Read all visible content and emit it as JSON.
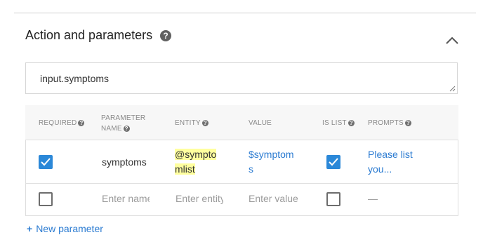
{
  "section": {
    "title": "Action and parameters",
    "help_icon": "?"
  },
  "action_input": {
    "value": "input.symptoms"
  },
  "table": {
    "headers": {
      "required": "REQUIRED",
      "parameter_name_line1": "PARAMETER",
      "parameter_name_line2": "NAME",
      "entity": "ENTITY",
      "value": "VALUE",
      "is_list": "IS LIST",
      "prompts": "PROMPTS",
      "help_icon": "?"
    },
    "rows": [
      {
        "required": true,
        "name": "symptoms",
        "entity_line1": "@sympto",
        "entity_line2": "mlist",
        "value_line1": "$symptom",
        "value_line2": "s",
        "is_list": true,
        "prompts_line1": "Please list",
        "prompts_line2": "you..."
      }
    ],
    "empty_row": {
      "required": false,
      "name_placeholder": "Enter name",
      "entity_placeholder": "Enter entity",
      "value_placeholder": "Enter value",
      "is_list": false,
      "prompts": "—"
    }
  },
  "new_parameter": {
    "plus": "+",
    "label": "New parameter"
  },
  "icons": {
    "help": "help-circle-icon",
    "collapse": "chevron-up-icon",
    "check": "check-icon",
    "add": "plus-icon"
  },
  "colors": {
    "accent": "#2b88d8",
    "link": "#2b7bd1",
    "highlight": "#ffff9e"
  }
}
